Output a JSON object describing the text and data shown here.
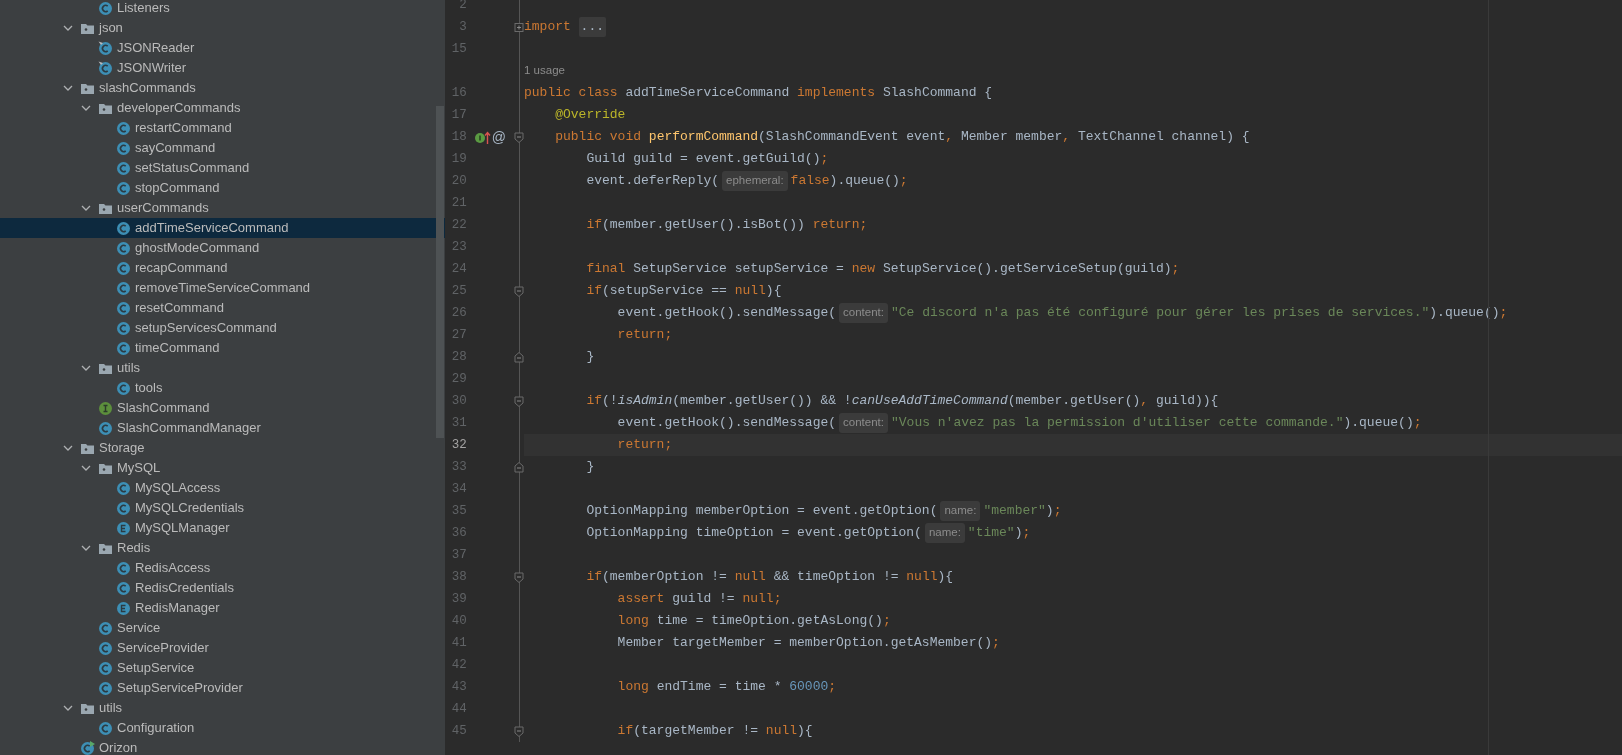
{
  "project_tree": [
    {
      "kind": "cut-off",
      "children": [
        {
          "kind": "class",
          "label": "Listeners",
          "selected": false
        }
      ]
    },
    {
      "kind": "folder",
      "label": "json",
      "expanded": true,
      "selected": false,
      "children": [
        {
          "kind": "class-pinned",
          "label": "JSONReader",
          "selected": false
        },
        {
          "kind": "class-pinned",
          "label": "JSONWriter",
          "selected": false
        }
      ]
    },
    {
      "kind": "folder",
      "label": "slashCommands",
      "expanded": true,
      "selected": false,
      "children": [
        {
          "kind": "folder",
          "label": "developerCommands",
          "expanded": true,
          "selected": false,
          "children": [
            {
              "kind": "class",
              "label": "restartCommand",
              "selected": false
            },
            {
              "kind": "class",
              "label": "sayCommand",
              "selected": false
            },
            {
              "kind": "class",
              "label": "setStatusCommand",
              "selected": false
            },
            {
              "kind": "class",
              "label": "stopCommand",
              "selected": false
            }
          ]
        },
        {
          "kind": "folder",
          "label": "userCommands",
          "expanded": true,
          "selected": false,
          "children": [
            {
              "kind": "class",
              "label": "addTimeServiceCommand",
              "selected": true
            },
            {
              "kind": "class",
              "label": "ghostModeCommand",
              "selected": false
            },
            {
              "kind": "class",
              "label": "recapCommand",
              "selected": false
            },
            {
              "kind": "class",
              "label": "removeTimeServiceCommand",
              "selected": false
            },
            {
              "kind": "class",
              "label": "resetCommand",
              "selected": false
            },
            {
              "kind": "class",
              "label": "setupServicesCommand",
              "selected": false
            },
            {
              "kind": "class",
              "label": "timeCommand",
              "selected": false
            }
          ]
        },
        {
          "kind": "folder",
          "label": "utils",
          "expanded": true,
          "selected": false,
          "children": [
            {
              "kind": "class",
              "label": "tools",
              "selected": false
            }
          ]
        },
        {
          "kind": "interface",
          "label": "SlashCommand",
          "selected": false
        },
        {
          "kind": "class",
          "label": "SlashCommandManager",
          "selected": false
        }
      ]
    },
    {
      "kind": "folder",
      "label": "Storage",
      "expanded": true,
      "selected": false,
      "children": [
        {
          "kind": "folder",
          "label": "MySQL",
          "expanded": true,
          "selected": false,
          "children": [
            {
              "kind": "class",
              "label": "MySQLAccess",
              "selected": false
            },
            {
              "kind": "class",
              "label": "MySQLCredentials",
              "selected": false
            },
            {
              "kind": "enum",
              "label": "MySQLManager",
              "selected": false
            }
          ]
        },
        {
          "kind": "folder",
          "label": "Redis",
          "expanded": true,
          "selected": false,
          "children": [
            {
              "kind": "class",
              "label": "RedisAccess",
              "selected": false
            },
            {
              "kind": "class",
              "label": "RedisCredentials",
              "selected": false
            },
            {
              "kind": "enum",
              "label": "RedisManager",
              "selected": false
            }
          ]
        },
        {
          "kind": "class",
          "label": "Service",
          "selected": false
        },
        {
          "kind": "class",
          "label": "ServiceProvider",
          "selected": false
        },
        {
          "kind": "class",
          "label": "SetupService",
          "selected": false
        },
        {
          "kind": "class",
          "label": "SetupServiceProvider",
          "selected": false
        }
      ]
    },
    {
      "kind": "folder",
      "label": "utils",
      "expanded": true,
      "selected": false,
      "children": [
        {
          "kind": "class",
          "label": "Configuration",
          "selected": false
        }
      ]
    },
    {
      "kind": "runnable",
      "label": "Orizon",
      "selected": false
    }
  ],
  "editor": {
    "lines": [
      {
        "kind": "code",
        "number": "2",
        "current": false
      },
      {
        "kind": "code",
        "number": "3",
        "current": false,
        "collapsed": true,
        "tokens": [
          {
            "kind": "keyword",
            "text": "import "
          },
          {
            "kind": "folded",
            "text": "..."
          }
        ]
      },
      {
        "kind": "code",
        "number": "15",
        "current": false
      },
      {
        "kind": "usage",
        "text": "1 usage"
      },
      {
        "kind": "code",
        "number": "16",
        "current": false,
        "tokens": [
          {
            "kind": "keyword",
            "text": "public class "
          },
          {
            "kind": "plain",
            "text": "addTimeServiceCommand "
          },
          {
            "kind": "keyword",
            "text": "implements "
          },
          {
            "kind": "plain",
            "text": "SlashCommand {"
          }
        ]
      },
      {
        "kind": "code",
        "number": "17",
        "current": false,
        "tokens": [
          {
            "kind": "annotation",
            "text": "    @Override"
          }
        ]
      },
      {
        "kind": "code",
        "number": "18",
        "current": false,
        "fold_start": true,
        "gutter_icon": true,
        "gutter_symbol": "@",
        "tokens": [
          {
            "kind": "keyword",
            "text": "    public void "
          },
          {
            "kind": "method",
            "text": "performCommand"
          },
          {
            "kind": "plain",
            "text": "(SlashCommandEvent event"
          },
          {
            "kind": "keyword",
            "text": ", "
          },
          {
            "kind": "plain",
            "text": "Member member"
          },
          {
            "kind": "keyword",
            "text": ", "
          },
          {
            "kind": "plain",
            "text": "TextChannel channel) {"
          }
        ]
      },
      {
        "kind": "code",
        "number": "19",
        "current": false,
        "tokens": [
          {
            "kind": "plain",
            "text": "        Guild guild = event.getGuild()"
          },
          {
            "kind": "keyword",
            "text": ";"
          }
        ]
      },
      {
        "kind": "code",
        "number": "20",
        "current": false,
        "tokens": [
          {
            "kind": "plain",
            "text": "        event.deferReply("
          },
          {
            "kind": "hint",
            "text": "ephemeral:"
          },
          {
            "kind": "keyword",
            "text": "false"
          },
          {
            "kind": "plain",
            "text": ").queue()"
          },
          {
            "kind": "keyword",
            "text": ";"
          }
        ]
      },
      {
        "kind": "code",
        "number": "21",
        "current": false
      },
      {
        "kind": "code",
        "number": "22",
        "current": false,
        "tokens": [
          {
            "kind": "keyword",
            "text": "        if"
          },
          {
            "kind": "plain",
            "text": "(member.getUser().isBot()) "
          },
          {
            "kind": "keyword",
            "text": "return;"
          }
        ]
      },
      {
        "kind": "code",
        "number": "23",
        "current": false
      },
      {
        "kind": "code",
        "number": "24",
        "current": false,
        "tokens": [
          {
            "kind": "keyword",
            "text": "        final "
          },
          {
            "kind": "plain",
            "text": "SetupService setupService = "
          },
          {
            "kind": "keyword",
            "text": "new "
          },
          {
            "kind": "plain",
            "text": "SetupService().getServiceSetup(guild)"
          },
          {
            "kind": "keyword",
            "text": ";"
          }
        ]
      },
      {
        "kind": "code",
        "number": "25",
        "current": false,
        "fold_start": true,
        "tokens": [
          {
            "kind": "keyword",
            "text": "        if"
          },
          {
            "kind": "plain",
            "text": "(setupService == "
          },
          {
            "kind": "keyword",
            "text": "null"
          },
          {
            "kind": "plain",
            "text": "){"
          }
        ]
      },
      {
        "kind": "code",
        "number": "26",
        "current": false,
        "tokens": [
          {
            "kind": "plain",
            "text": "            event.getHook().sendMessage("
          },
          {
            "kind": "hint",
            "text": "content:"
          },
          {
            "kind": "string",
            "text": "\"Ce discord n'a pas été configuré pour gérer les prises de services.\""
          },
          {
            "kind": "plain",
            "text": ").queue()"
          },
          {
            "kind": "keyword",
            "text": ";"
          }
        ]
      },
      {
        "kind": "code",
        "number": "27",
        "current": false,
        "tokens": [
          {
            "kind": "keyword",
            "text": "            return;"
          }
        ]
      },
      {
        "kind": "code",
        "number": "28",
        "current": false,
        "fold_end": true,
        "tokens": [
          {
            "kind": "plain",
            "text": "        }"
          }
        ]
      },
      {
        "kind": "code",
        "number": "29",
        "current": false
      },
      {
        "kind": "code",
        "number": "30",
        "current": false,
        "fold_start": true,
        "tokens": [
          {
            "kind": "keyword",
            "text": "        if"
          },
          {
            "kind": "plain",
            "text": "(!"
          },
          {
            "kind": "static",
            "text": "isAdmin"
          },
          {
            "kind": "plain",
            "text": "(member.getUser()) && !"
          },
          {
            "kind": "static",
            "text": "canUseAddTimeCommand"
          },
          {
            "kind": "plain",
            "text": "(member.getUser()"
          },
          {
            "kind": "keyword",
            "text": ", "
          },
          {
            "kind": "plain",
            "text": "guild)){"
          }
        ]
      },
      {
        "kind": "code",
        "number": "31",
        "current": false,
        "tokens": [
          {
            "kind": "plain",
            "text": "            event.getHook().sendMessage("
          },
          {
            "kind": "hint",
            "text": "content:"
          },
          {
            "kind": "string",
            "text": "\"Vous n'avez pas la permission d'utiliser cette commande.\""
          },
          {
            "kind": "plain",
            "text": ").queue()"
          },
          {
            "kind": "keyword",
            "text": ";"
          }
        ]
      },
      {
        "kind": "code",
        "number": "32",
        "current": true,
        "tokens": [
          {
            "kind": "keyword",
            "text": "            return;"
          }
        ]
      },
      {
        "kind": "code",
        "number": "33",
        "current": false,
        "fold_end": true,
        "tokens": [
          {
            "kind": "plain",
            "text": "        }"
          }
        ]
      },
      {
        "kind": "code",
        "number": "34",
        "current": false
      },
      {
        "kind": "code",
        "number": "35",
        "current": false,
        "tokens": [
          {
            "kind": "plain",
            "text": "        OptionMapping memberOption = event.getOption("
          },
          {
            "kind": "hint",
            "text": "name:"
          },
          {
            "kind": "string",
            "text": "\"member\""
          },
          {
            "kind": "plain",
            "text": ")"
          },
          {
            "kind": "keyword",
            "text": ";"
          }
        ]
      },
      {
        "kind": "code",
        "number": "36",
        "current": false,
        "tokens": [
          {
            "kind": "plain",
            "text": "        OptionMapping timeOption = event.getOption("
          },
          {
            "kind": "hint",
            "text": "name:"
          },
          {
            "kind": "string",
            "text": "\"time\""
          },
          {
            "kind": "plain",
            "text": ")"
          },
          {
            "kind": "keyword",
            "text": ";"
          }
        ]
      },
      {
        "kind": "code",
        "number": "37",
        "current": false
      },
      {
        "kind": "code",
        "number": "38",
        "current": false,
        "fold_start": true,
        "tokens": [
          {
            "kind": "keyword",
            "text": "        if"
          },
          {
            "kind": "plain",
            "text": "(memberOption != "
          },
          {
            "kind": "keyword",
            "text": "null"
          },
          {
            "kind": "plain",
            "text": " && timeOption != "
          },
          {
            "kind": "keyword",
            "text": "null"
          },
          {
            "kind": "plain",
            "text": "){"
          }
        ]
      },
      {
        "kind": "code",
        "number": "39",
        "current": false,
        "tokens": [
          {
            "kind": "keyword",
            "text": "            assert "
          },
          {
            "kind": "plain",
            "text": "guild != "
          },
          {
            "kind": "keyword",
            "text": "null;"
          }
        ]
      },
      {
        "kind": "code",
        "number": "40",
        "current": false,
        "tokens": [
          {
            "kind": "keyword",
            "text": "            long "
          },
          {
            "kind": "plain",
            "text": "time = timeOption.getAsLong()"
          },
          {
            "kind": "keyword",
            "text": ";"
          }
        ]
      },
      {
        "kind": "code",
        "number": "41",
        "current": false,
        "tokens": [
          {
            "kind": "plain",
            "text": "            Member targetMember = memberOption.getAsMember()"
          },
          {
            "kind": "keyword",
            "text": ";"
          }
        ]
      },
      {
        "kind": "code",
        "number": "42",
        "current": false
      },
      {
        "kind": "code",
        "number": "43",
        "current": false,
        "tokens": [
          {
            "kind": "keyword",
            "text": "            long "
          },
          {
            "kind": "plain",
            "text": "endTime = time * "
          },
          {
            "kind": "number",
            "text": "60000"
          },
          {
            "kind": "keyword",
            "text": ";"
          }
        ]
      },
      {
        "kind": "code",
        "number": "44",
        "current": false
      },
      {
        "kind": "code",
        "number": "45",
        "current": false,
        "fold_start": true,
        "tokens": [
          {
            "kind": "keyword",
            "text": "            if"
          },
          {
            "kind": "plain",
            "text": "(targetMember != "
          },
          {
            "kind": "keyword",
            "text": "null"
          },
          {
            "kind": "plain",
            "text": "){"
          }
        ]
      }
    ]
  }
}
